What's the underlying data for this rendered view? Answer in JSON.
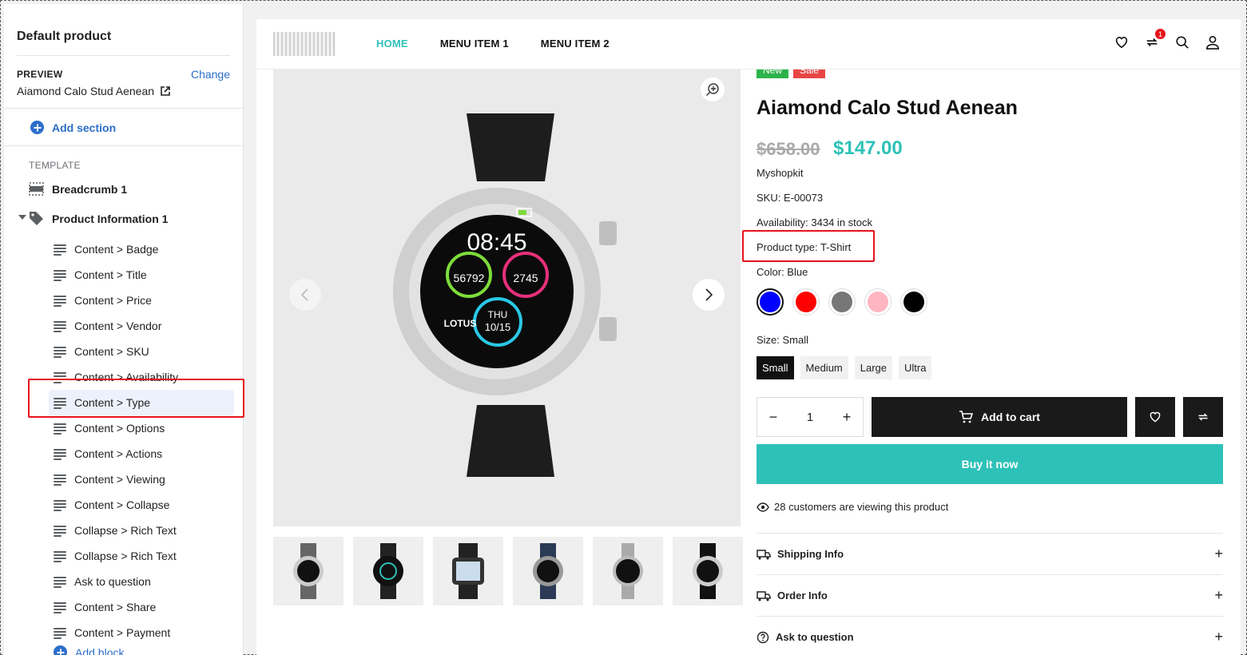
{
  "sidebar": {
    "title": "Default product",
    "preview_label": "PREVIEW",
    "change_label": "Change",
    "preview_value": "Aiamond Calo Stud Aenean",
    "add_section_label": "Add section",
    "template_label": "TEMPLATE",
    "breadcrumb_label": "Breadcrumb 1",
    "product_info_label": "Product Information 1",
    "blocks": [
      "Content > Badge",
      "Content > Title",
      "Content > Price",
      "Content > Vendor",
      "Content > SKU",
      "Content > Availability",
      "Content > Type",
      "Content > Options",
      "Content > Actions",
      "Content > Viewing",
      "Content > Collapse",
      "Collapse > Rich Text",
      "Collapse > Rich Text",
      "Ask to question",
      "Content > Share",
      "Content > Payment"
    ],
    "active_block": "Content > Type",
    "add_block_label": "Add block"
  },
  "header": {
    "nav": [
      "HOME",
      "MENU ITEM 1",
      "MENU ITEM 2"
    ],
    "active_nav": "HOME",
    "cart_count": "1",
    "icons": [
      "heart-icon",
      "compare-icon",
      "search-icon",
      "user-icon"
    ]
  },
  "product": {
    "badges": [
      "New",
      "Sale"
    ],
    "title": "Aiamond Calo Stud Aenean",
    "price_old": "$658.00",
    "price_new": "$147.00",
    "vendor": "Myshopkit",
    "sku": "SKU: E-00073",
    "availability": "Availability: 3434 in stock",
    "type": "Product type: T-Shirt",
    "color_label": "Color: Blue",
    "colors": [
      "#0000ff",
      "#ff0000",
      "#777777",
      "#ffb6c1",
      "#000000"
    ],
    "size_label": "Size: Small",
    "sizes": [
      "Small",
      "Medium",
      "Large",
      "Ultra"
    ],
    "quantity": "1",
    "add_to_cart": "Add to cart",
    "buy_now": "Buy it now",
    "viewing": "28 customers are viewing this product",
    "collapse": [
      "Shipping Info",
      "Order Info",
      "Ask to question"
    ],
    "watch_time": "08:45",
    "watch_steps": "56792",
    "watch_cal": "2745",
    "watch_day": "THU",
    "watch_date": "10/15",
    "watch_brand": "LOTUS"
  },
  "colors": {
    "accent": "#2ec1b8",
    "link": "#2c6ecb",
    "highlight": "#e5131c",
    "badge_new": "#2db34a",
    "badge_sale": "#e84545"
  }
}
